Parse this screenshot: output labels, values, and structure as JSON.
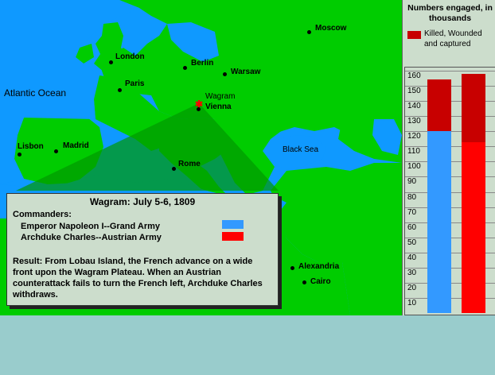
{
  "map": {
    "cities": [
      {
        "name": "Moscow"
      },
      {
        "name": "London"
      },
      {
        "name": "Berlin"
      },
      {
        "name": "Warsaw"
      },
      {
        "name": "Paris"
      },
      {
        "name": "Wagram"
      },
      {
        "name": "Vienna"
      },
      {
        "name": "Lisbon"
      },
      {
        "name": "Madrid"
      },
      {
        "name": "Rome"
      },
      {
        "name": "Alexandria"
      },
      {
        "name": "Cairo"
      }
    ],
    "seas": [
      "Atlantic Ocean",
      "Black Sea"
    ],
    "colors": {
      "sea": "#0f99ff",
      "land": "#00cc00",
      "highlight": "#009900",
      "marker": "#ff0000"
    }
  },
  "info": {
    "title": "Wagram: July 5-6, 1809",
    "commanders_label": "Commanders:",
    "french": "Emperor Napoleon I--Grand Army",
    "austrian": "Archduke Charles--Austrian Army",
    "french_color": "#3399ff",
    "austrian_color": "#ff0000",
    "result": "Result: From Lobau Island, the French advance on a wide front upon the Wagram Plateau. When an Austrian counterattack fails to turn the French left, Archduke Charles withdraws."
  },
  "panel": {
    "title": "Numbers engaged, in thousands",
    "legend": "Killed, Wounded and captured",
    "legend_color": "#c80000"
  },
  "chart_data": {
    "type": "bar",
    "title": "Numbers engaged, in thousands",
    "ylim": [
      0,
      160
    ],
    "ticks": [
      10,
      20,
      30,
      40,
      50,
      60,
      70,
      80,
      90,
      100,
      110,
      120,
      130,
      140,
      150,
      160
    ],
    "series": [
      {
        "name": "Emperor Napoleon I--Grand Army",
        "engaged": 154,
        "casualties": 34,
        "color": "#3399ff",
        "loss_color": "#c80000"
      },
      {
        "name": "Archduke Charles--Austrian Army",
        "engaged": 158,
        "casualties": 45,
        "color": "#ff0000",
        "loss_color": "#c80000"
      }
    ],
    "legend": [
      "Killed, Wounded and captured"
    ]
  }
}
